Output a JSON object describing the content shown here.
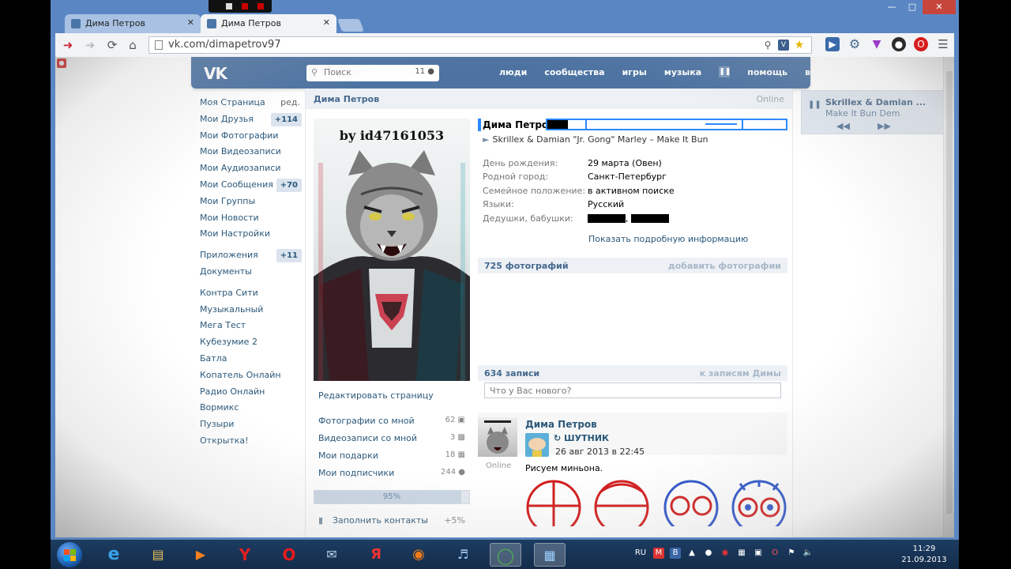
{
  "browser": {
    "tabs": [
      {
        "label": "Дима Петров"
      },
      {
        "label": "Дима Петров"
      }
    ],
    "url": "vk.com/dimapetrov97"
  },
  "vk": {
    "search": {
      "placeholder": "Поиск",
      "count": "11"
    },
    "menu": [
      "люди",
      "сообщества",
      "игры",
      "музыка",
      "помощь",
      "выйти"
    ],
    "nav": [
      {
        "label": "Моя Страница",
        "aux": "ред."
      },
      {
        "label": "Мои Друзья",
        "badge": "+114"
      },
      {
        "label": "Мои Фотографии"
      },
      {
        "label": "Мои Видеозаписи"
      },
      {
        "label": "Мои Аудиозаписи"
      },
      {
        "label": "Мои Сообщения",
        "badge": "+70"
      },
      {
        "label": "Мои Группы"
      },
      {
        "label": "Мои Новости"
      },
      {
        "label": "Мои Настройки"
      }
    ],
    "nav2": [
      {
        "label": "Приложения",
        "badge": "+11"
      },
      {
        "label": "Документы"
      }
    ],
    "apps": [
      "Контра Сити",
      "Музыкальный",
      "Мега Тест",
      "Кубезумие 2",
      "Батла",
      "Копатель Онлайн",
      "Радио Онлайн",
      "Вормикс",
      "Пузыри",
      "Открытка!"
    ],
    "page_title": "Дима Петров",
    "page_status": "Online",
    "avatar_caption": "by id47161053",
    "edit_page": "Редактировать страницу",
    "counters": [
      {
        "label": "Фотографии со мной",
        "num": "62"
      },
      {
        "label": "Видеозаписи со мной",
        "num": "3"
      },
      {
        "label": "Мои подарки",
        "num": "18"
      },
      {
        "label": "Мои подписчики",
        "num": "244"
      }
    ],
    "progress": {
      "value": 95,
      "label": "95%"
    },
    "fill_contacts": {
      "label": "Заполнить контакты",
      "pct": "+5%"
    },
    "profile_name": "Дима Петров",
    "now_playing": "Skrillex & Damian \"Jr. Gong\" Marley – Make It Bun Dem",
    "info": [
      {
        "k": "День рождения:",
        "v": "29 марта (Овен)"
      },
      {
        "k": "Родной город:",
        "v": "Санкт-Петербург"
      },
      {
        "k": "Семейное положение:",
        "v": "в активном поиске"
      },
      {
        "k": "Языки:",
        "v": "Русский"
      },
      {
        "k": "Дедушки, бабушки:",
        "v": ","
      }
    ],
    "more_info": "Показать подробную информацию",
    "photos": {
      "title": "725 фотографий",
      "action": "добавить фотографии"
    },
    "wall": {
      "title": "634 записи",
      "action": "к записям Димы",
      "placeholder": "Что у Вас нового?"
    },
    "post": {
      "author": "Дима Петров",
      "author_status": "Online",
      "repost_from": "ШУТНИК",
      "date": "26 авг 2013 в 22:45",
      "text": "Рисуем миньона."
    },
    "player": {
      "artist": "Skrillex & Damian ...",
      "track": "Make It Bun Dem"
    }
  },
  "taskbar": {
    "lang": "RU",
    "time": "11:29",
    "date": "21.09.2013"
  },
  "colors": {
    "vk_blue": "#4d73a2",
    "link": "#2b587a",
    "status_outline": "#2a87ff"
  }
}
